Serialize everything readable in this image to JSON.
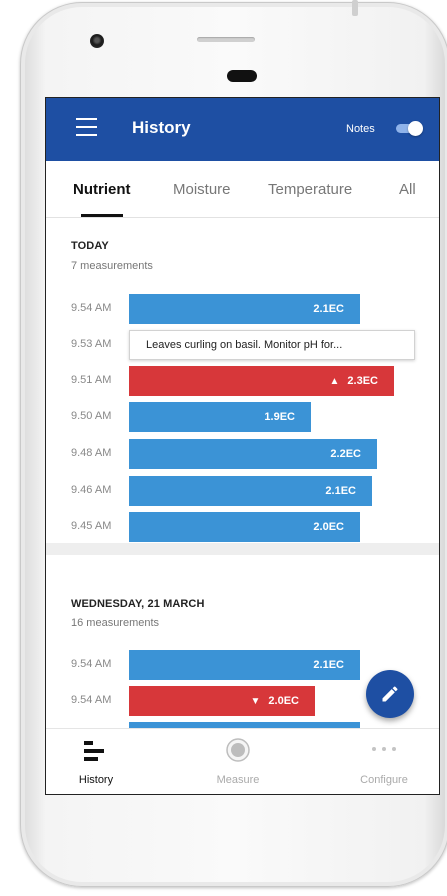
{
  "colors": {
    "primary": "#1e4fa3",
    "bar_normal": "#3b93d6",
    "bar_alert": "#d7373a"
  },
  "appbar": {
    "menu_icon": "hamburger-menu-icon",
    "title": "History",
    "notes_label": "Notes",
    "notes_toggle_on": true
  },
  "tabs": [
    {
      "label": "Nutrient",
      "active": true
    },
    {
      "label": "Moisture",
      "active": false
    },
    {
      "label": "Temperature",
      "active": false
    },
    {
      "label": "All",
      "active": false
    }
  ],
  "today": {
    "title": "TODAY",
    "count": "7 measurements",
    "rows": [
      {
        "time": "9.54 AM",
        "value": "2.1EC",
        "status": "normal"
      },
      {
        "time": "9.53 AM",
        "note": "Leaves curling on basil. Monitor pH for..."
      },
      {
        "time": "9.51 AM",
        "value": "2.3EC",
        "status": "alert",
        "trend": "up"
      },
      {
        "time": "9.50 AM",
        "value": "1.9EC",
        "status": "normal"
      },
      {
        "time": "9.48 AM",
        "value": "2.2EC",
        "status": "normal"
      },
      {
        "time": "9.46 AM",
        "value": "2.1EC",
        "status": "normal"
      },
      {
        "time": "9.45 AM",
        "value": "2.0EC",
        "status": "normal"
      }
    ]
  },
  "wednesday": {
    "title": "WEDNESDAY, 21 MARCH",
    "count": "16 measurements",
    "rows": [
      {
        "time": "9.54 AM",
        "value": "2.1EC",
        "status": "normal"
      },
      {
        "time": "9.54 AM",
        "value": "2.0EC",
        "status": "alert",
        "trend": "down"
      }
    ]
  },
  "fab": {
    "icon": "pencil-edit-icon"
  },
  "bottom_nav": [
    {
      "label": "History",
      "icon": "history-bars-icon",
      "active": true
    },
    {
      "label": "Measure",
      "icon": "measure-circle-icon",
      "active": false
    },
    {
      "label": "Configure",
      "icon": "more-dots-icon",
      "active": false
    }
  ]
}
